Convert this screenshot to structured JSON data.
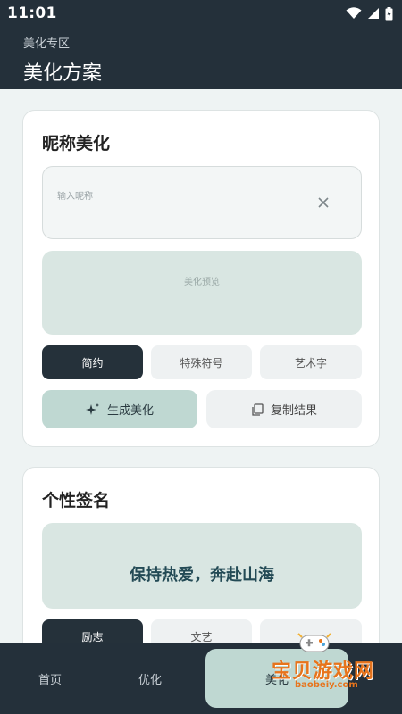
{
  "status_bar": {
    "time": "11:01"
  },
  "header": {
    "subtitle": "美化专区",
    "title": "美化方案"
  },
  "nickname_card": {
    "title": "昵称美化",
    "input_placeholder": "输入昵称",
    "preview_placeholder": "美化预览",
    "styles": [
      "简约",
      "特殊符号",
      "艺术字"
    ],
    "generate_label": "生成美化",
    "copy_label": "复制结果"
  },
  "signature_card": {
    "title": "个性签名",
    "signature_text": "保持热爱，奔赴山海",
    "styles": [
      "励志",
      "文艺",
      ""
    ]
  },
  "bottom_nav": {
    "items": [
      "首页",
      "优化",
      "美化"
    ],
    "active_index": 2
  },
  "watermark": {
    "text": "宝贝游戏网",
    "url": "baobeiy.com"
  }
}
